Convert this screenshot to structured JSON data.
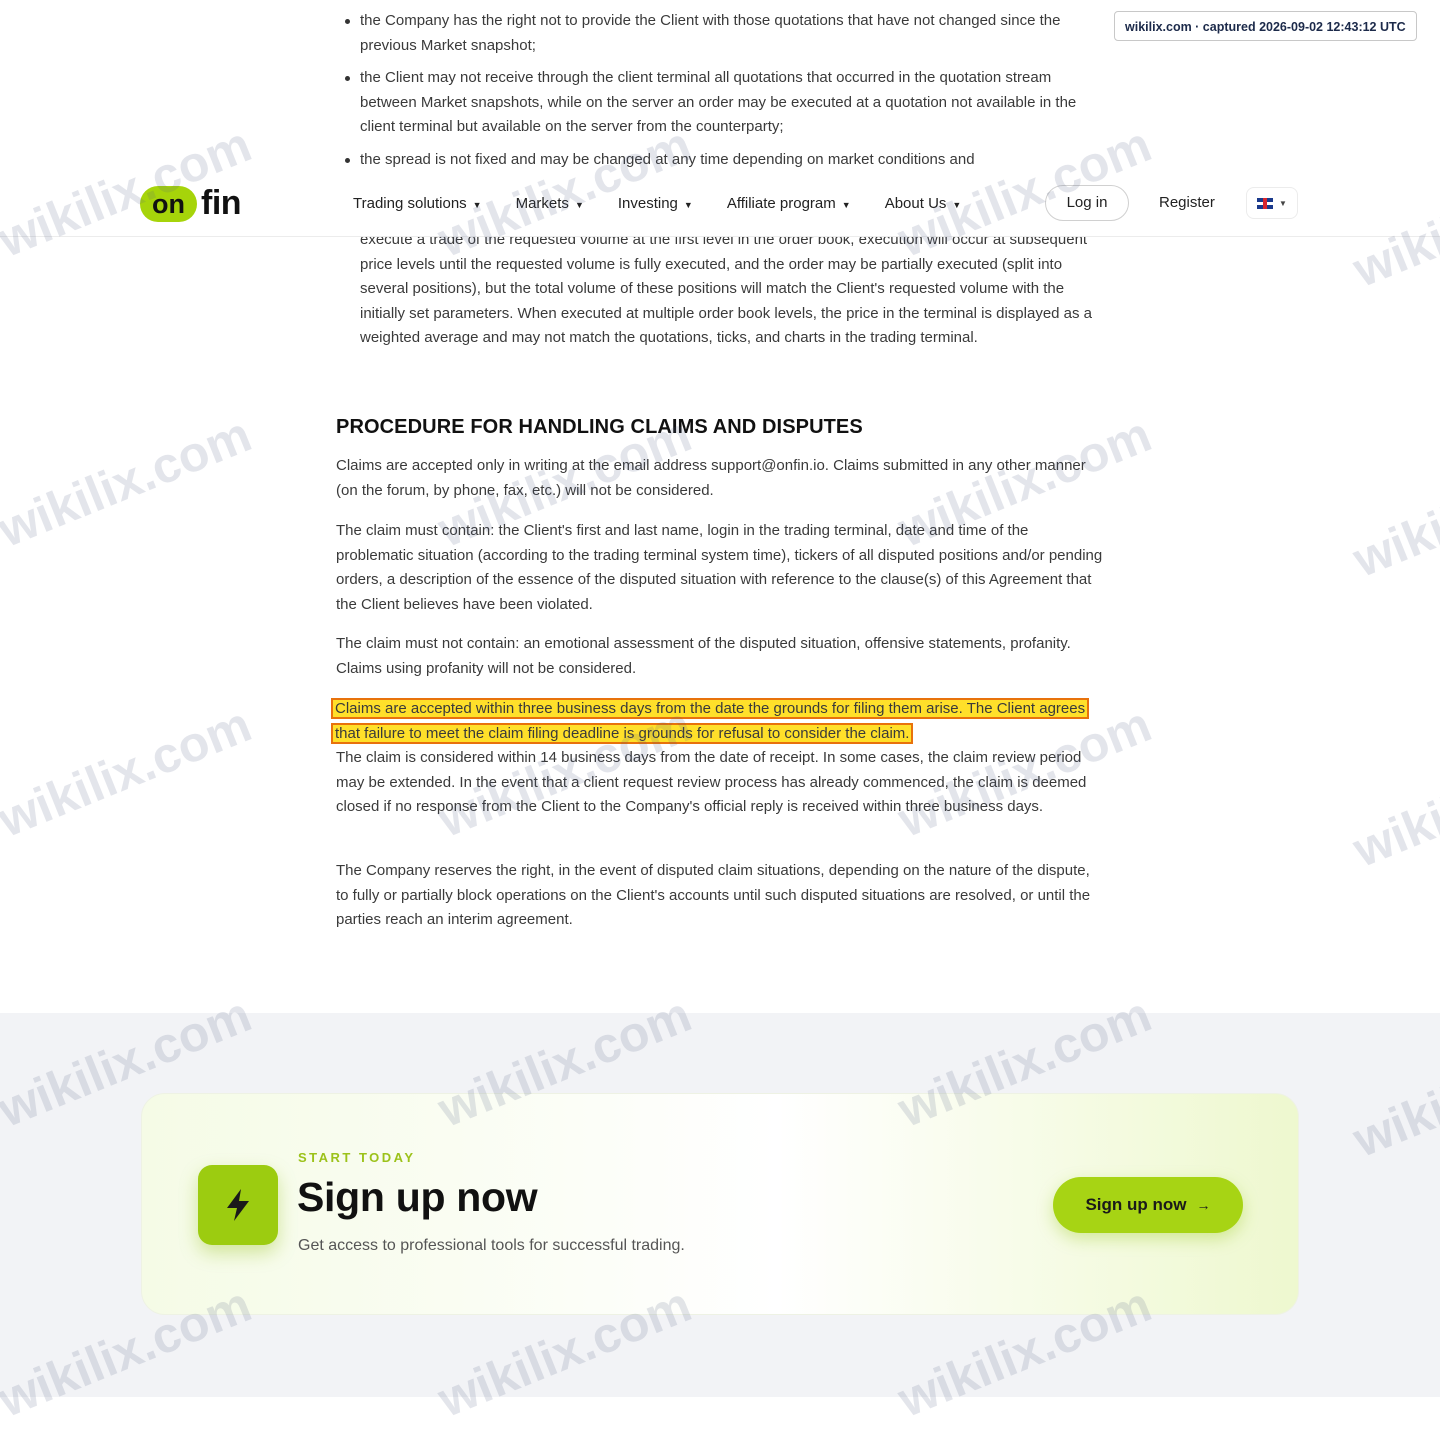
{
  "watermark_badge": "wikilix.com · captured 2026-09-02 12:43:12 UTC",
  "watermark_text": "wikilix.com",
  "header": {
    "logo_on": "on",
    "logo_fin": "fin",
    "nav": [
      {
        "label": "Trading solutions"
      },
      {
        "label": "Markets"
      },
      {
        "label": "Investing"
      },
      {
        "label": "Affiliate program"
      },
      {
        "label": "About Us"
      }
    ],
    "login": "Log in",
    "register": "Register",
    "language": "EN (UK flag)"
  },
  "article": {
    "bullets": [
      "the Company has the right not to provide the Client with those quotations that have not changed since the previous Market snapshot;",
      "the Client may not receive through the client terminal all quotations that occurred in the quotation stream between Market snapshots, while on the server an order may be executed at a quotation not available in the client terminal but available on the server from the counterparty;",
      "the spread is not fixed and may be changed at any time depending on market conditions and"
    ],
    "continued_text": "execute a trade of the requested volume at the first level in the order book, execution will occur at subsequent price levels until the requested volume is fully executed, and the order may be partially executed (split into several positions), but the total volume of these positions will match the Client's requested volume with the initially set parameters. When executed at multiple order book levels, the price in the terminal is displayed as a weighted average and may not match the quotations, ticks, and charts in the trading terminal.",
    "heading": "PROCEDURE FOR HANDLING CLAIMS AND DISPUTES",
    "p1": "Claims are accepted only in writing at the email address support@onfin.io. Claims submitted in any other manner (on the forum, by phone, fax, etc.) will not be considered.",
    "p2": "The claim must contain: the Client's first and last name, login in the trading terminal, date and time of the problematic situation (according to the trading terminal system time), tickers of all disputed positions and/or pending orders, a description of the essence of the disputed situation with reference to the clause(s) of this Agreement that the Client believes have been violated.",
    "p3": "The claim must not contain: an emotional assessment of the disputed situation, offensive statements, profanity. Claims using profanity will not be considered.",
    "highlight": "Claims are accepted within three business days from the date the grounds for filing them arise. The Client agrees that failure to meet the claim filing deadline is grounds for refusal to consider the claim.",
    "p4": "The claim is considered within 14 business days from the date of receipt. In some cases, the claim review period may be extended. In the event that a client request review process has already commenced, the claim is deemed closed if no response from the Client to the Company's official reply is received within three business days.",
    "p5": "The Company reserves the right, in the event of disputed claim situations, depending on the nature of the dispute, to fully or partially block operations on the Client's accounts until such disputed situations are resolved, or until the parties reach an interim agreement."
  },
  "cta": {
    "kicker": "START TODAY",
    "title": "Sign up now",
    "subtitle": "Get access to professional tools for successful trading.",
    "button": "Sign up now",
    "button_arrow": "→",
    "icon": "lightning-icon"
  },
  "colors": {
    "brand_green": "#a6d40a",
    "highlight_fill": "#ffe02a",
    "highlight_border": "#e8720c"
  }
}
